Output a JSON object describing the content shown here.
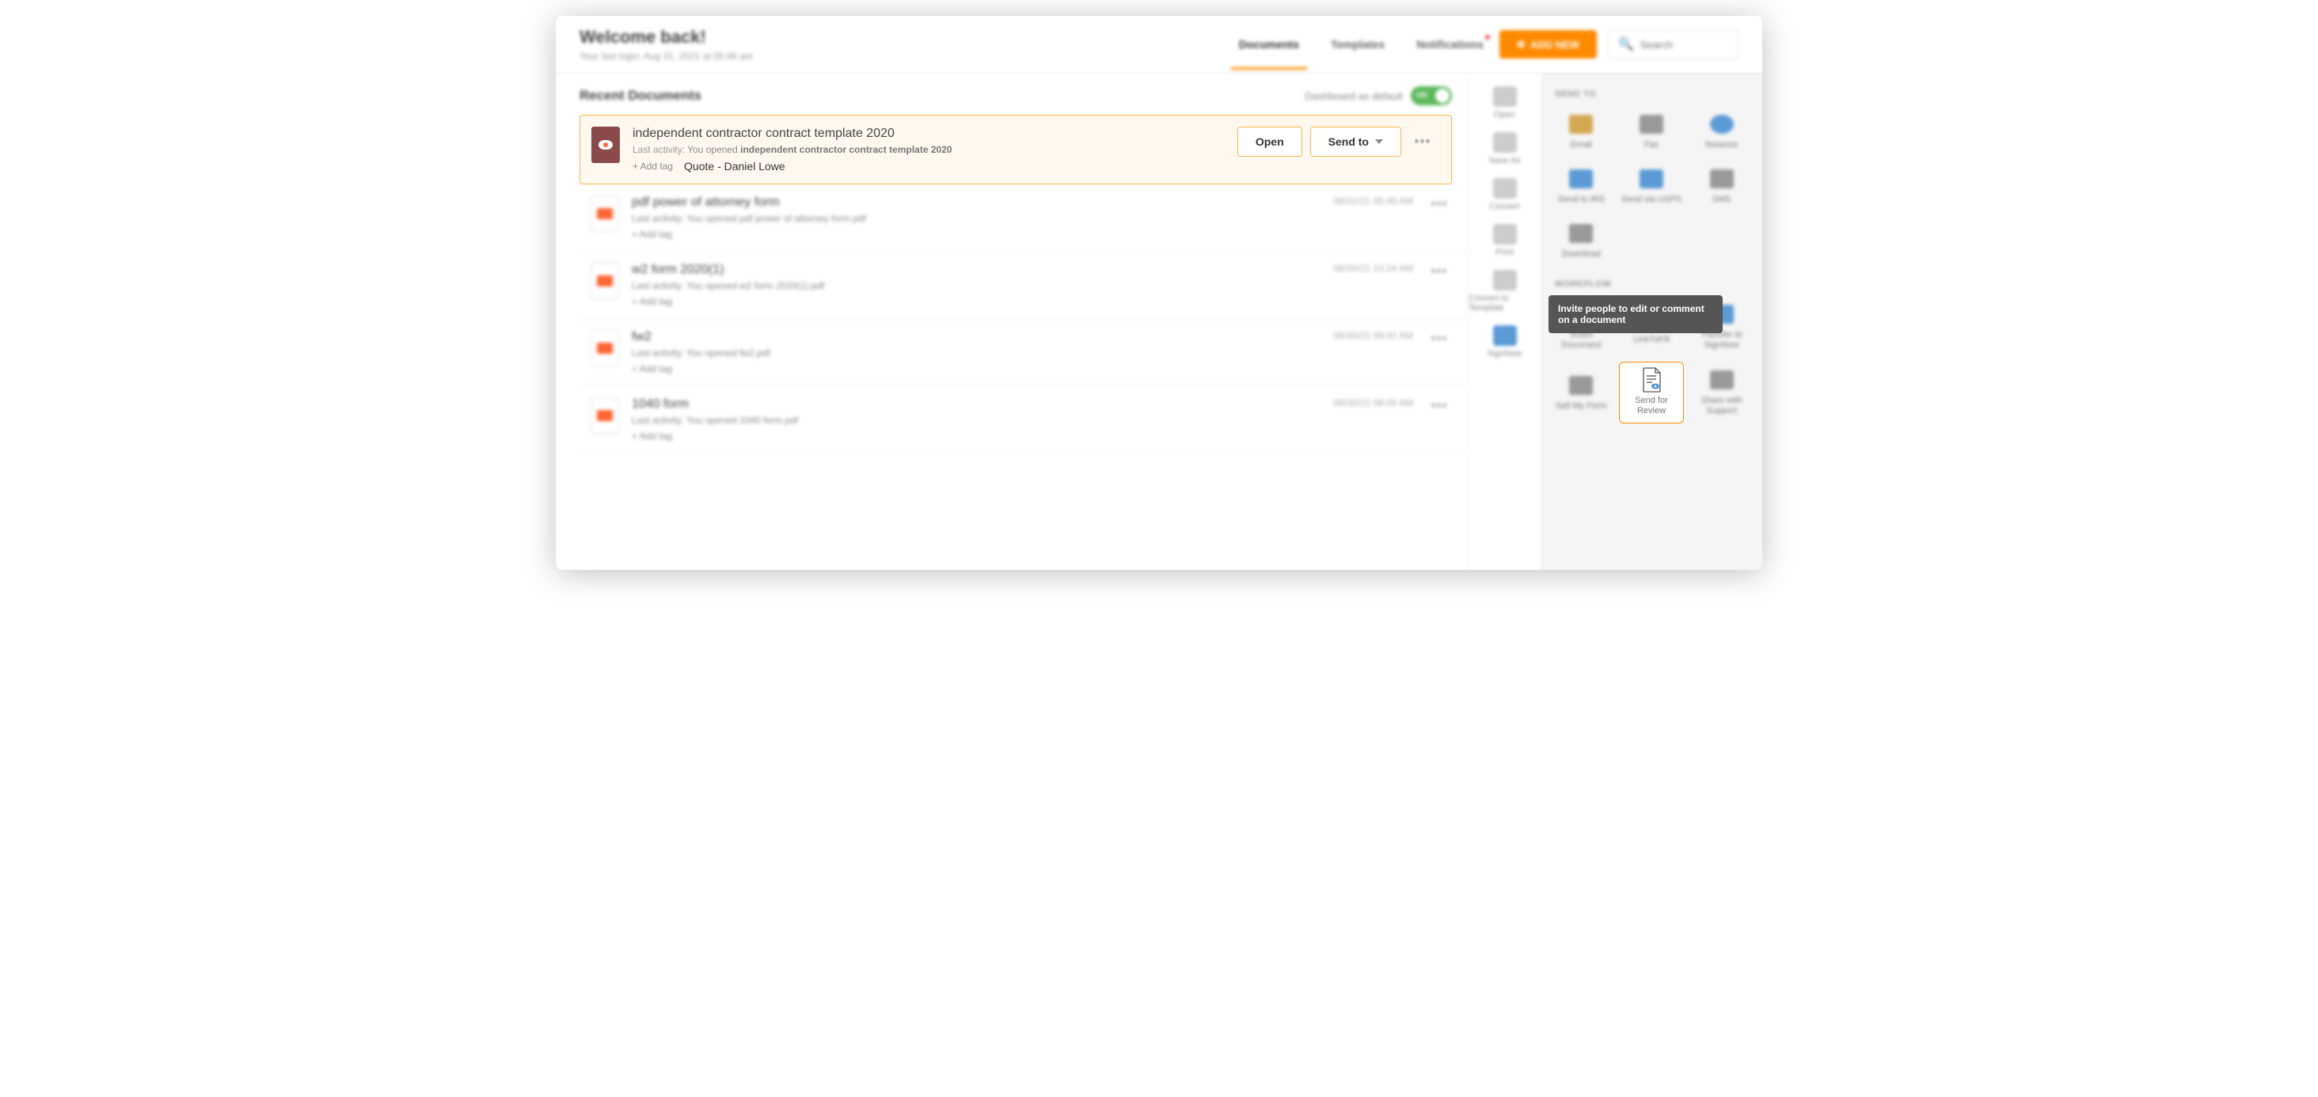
{
  "header": {
    "welcome_title": "Welcome back!",
    "welcome_sub": "Your last login: Aug 31, 2021 at 05:46 am",
    "tabs": {
      "documents": "Documents",
      "templates": "Templates",
      "notifications": "Notifications"
    },
    "add_new": "ADD NEW",
    "search_placeholder": "Search"
  },
  "section": {
    "title": "Recent Documents",
    "dashboard_default": "Dashboard as default",
    "toggle": "ON"
  },
  "selected_doc": {
    "title": "independent contractor contract template 2020",
    "activity_prefix": "Last activity:",
    "activity_action": "You opened",
    "activity_name": "independent contractor contract template 2020",
    "add_tag": "+ Add tag",
    "quote_tag": "Quote - Daniel Lowe",
    "open_btn": "Open",
    "sendto_btn": "Send to"
  },
  "docs": [
    {
      "title": "pdf power of attorney form",
      "activity": "Last activity: You opened pdf power of attorney form.pdf",
      "add_tag": "+ Add tag",
      "date": "08/31/21 05:46 AM"
    },
    {
      "title": "w2 form 2020(1)",
      "activity": "Last activity: You opened w2 form 2020(1).pdf",
      "add_tag": "+ Add tag",
      "date": "08/30/21 10:24 AM"
    },
    {
      "title": "fw2",
      "activity": "Last activity: You opened fw2.pdf",
      "add_tag": "+ Add tag",
      "date": "08/30/21 09:42 AM"
    },
    {
      "title": "1040 form",
      "activity": "Last activity: You opened 1040 form.pdf",
      "add_tag": "+ Add tag",
      "date": "08/30/21 08:06 AM"
    }
  ],
  "strip": {
    "open": "Open",
    "save_as": "Save As",
    "convert": "Convert",
    "print": "Print",
    "convert_template": "Convert to Template",
    "signnow": "SignNow"
  },
  "panel": {
    "send_to_title": "SEND TO",
    "workflow_title": "WORKFLOW",
    "items": {
      "email": "Email",
      "fax": "Fax",
      "notarize": "Notarize",
      "send_irs": "Send to IRS",
      "send_usps": "Send via USPS",
      "sms": "SMS",
      "download": "Download",
      "share_doc": "Share Document",
      "linktofill": "LinkToFill",
      "transfer_signnow": "Transfer to SignNow",
      "sell_form": "Sell My Form",
      "send_review": "Send for Review",
      "share_support": "Share with Support"
    },
    "tooltip": "Invite people to edit or comment on a document"
  }
}
